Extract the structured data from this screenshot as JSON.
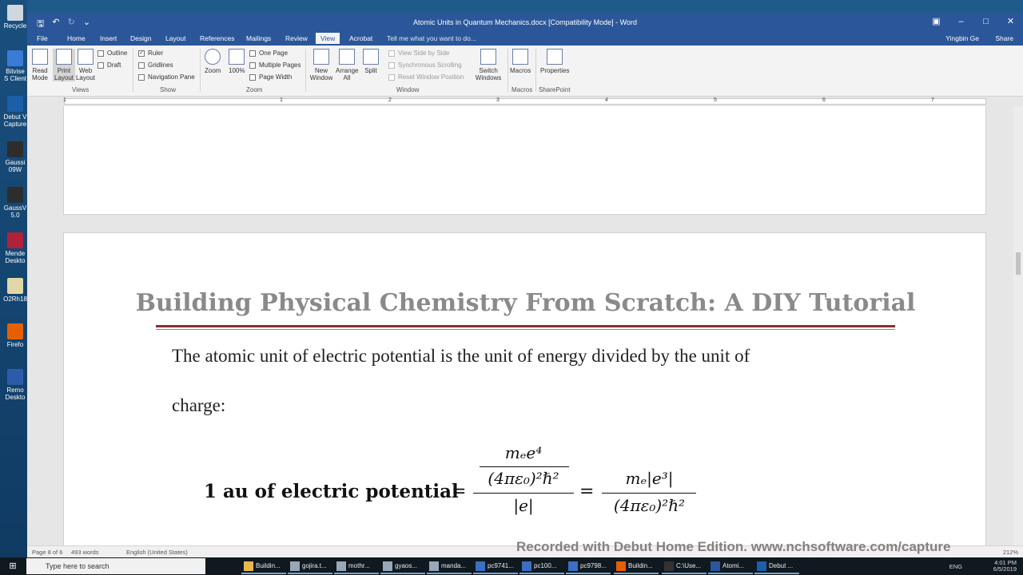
{
  "desktop_icons": [
    {
      "label": "Recycle",
      "color": "#cfd8e0"
    },
    {
      "label": "Bitvise S Client",
      "color": "#3a7bd5"
    },
    {
      "label": "Debut V Capture",
      "color": "#1b5fa8"
    },
    {
      "label": "Gaussi 09W",
      "color": "#2d2d2d"
    },
    {
      "label": "GaussV 5.0",
      "color": "#2d2d2d"
    },
    {
      "label": "Mende Deskto",
      "color": "#b0213a"
    },
    {
      "label": "O2Rh18",
      "color": "#e0d7a8"
    },
    {
      "label": "Firefo",
      "color": "#e66000"
    },
    {
      "label": "Remo Deskto",
      "color": "#2a5caa"
    }
  ],
  "window": {
    "title": "Atomic Units in Quantum Mechanics.docx [Compatibility Mode] - Word"
  },
  "tabs": [
    "File",
    "Home",
    "Insert",
    "Design",
    "Layout",
    "References",
    "Mailings",
    "Review",
    "View",
    "Acrobat"
  ],
  "active_tab": "View",
  "tell_me": "Tell me what you want to do...",
  "user": "Yingbin Ge",
  "share": "Share",
  "ribbon": {
    "views": {
      "read_mode": "Read Mode",
      "print_layout": "Print Layout",
      "web_layout": "Web Layout",
      "outline": "Outline",
      "draft": "Draft",
      "group": "Views"
    },
    "show": {
      "ruler": "Ruler",
      "gridlines": "Gridlines",
      "navigation_pane": "Navigation Pane",
      "group": "Show"
    },
    "zoom": {
      "zoom": "Zoom",
      "hundred": "100%",
      "one_page": "One Page",
      "multiple_pages": "Multiple Pages",
      "page_width": "Page Width",
      "group": "Zoom"
    },
    "window": {
      "new_window": "New Window",
      "arrange_all": "Arrange All",
      "split": "Split",
      "view_side": "View Side by Side",
      "sync_scroll": "Synchronous Scrolling",
      "reset_pos": "Reset Window Position",
      "switch": "Switch Windows",
      "group": "Window"
    },
    "macros": {
      "label": "Macros",
      "group": "Macros"
    },
    "sharepoint": {
      "label": "Properties",
      "group": "SharePoint"
    }
  },
  "ruler_numbers": [
    "1",
    "1",
    "2",
    "3",
    "4",
    "5",
    "6",
    "7"
  ],
  "document": {
    "heading": "Building Physical Chemistry From Scratch: A DIY Tutorial",
    "para_line1": "The atomic unit of electric potential is the unit of energy divided by the unit of",
    "para_line2": "charge:",
    "eq_lhs": "1 au of electric potential",
    "eq_num1": "mₑe⁴",
    "eq_den1a": "(4πε₀)²ℏ²",
    "eq_den1b": "|e|",
    "eq_num2": "mₑ|e³|",
    "eq_den2": "(4πε₀)²ℏ²"
  },
  "status": {
    "page": "Page 8 of 6",
    "words": "493 words",
    "language": "English (United States)",
    "zoom": "212%"
  },
  "watermark": "Recorded with Debut Home Edition. www.nchsoftware.com/capture",
  "taskbar": {
    "search": "Type here to search",
    "tasks": [
      {
        "label": "Buildin...",
        "color": "#e8b84a"
      },
      {
        "label": "gojira.t...",
        "color": "#9aa7b8"
      },
      {
        "label": "mothr...",
        "color": "#9aa7b8"
      },
      {
        "label": "gyaos...",
        "color": "#9aa7b8"
      },
      {
        "label": "manda...",
        "color": "#9aa7b8"
      },
      {
        "label": "pc9741...",
        "color": "#3b6fc2"
      },
      {
        "label": "pc100...",
        "color": "#3b6fc2"
      },
      {
        "label": "pc9798...",
        "color": "#3b6fc2"
      },
      {
        "label": "Buildin...",
        "color": "#e66000"
      },
      {
        "label": "C:\\Use...",
        "color": "#333333"
      },
      {
        "label": "Atomi...",
        "color": "#2b579a"
      },
      {
        "label": "Debut ...",
        "color": "#1b5fa8"
      }
    ],
    "language": "ENG",
    "time": "4:01 PM",
    "date": "6/5/2019"
  }
}
